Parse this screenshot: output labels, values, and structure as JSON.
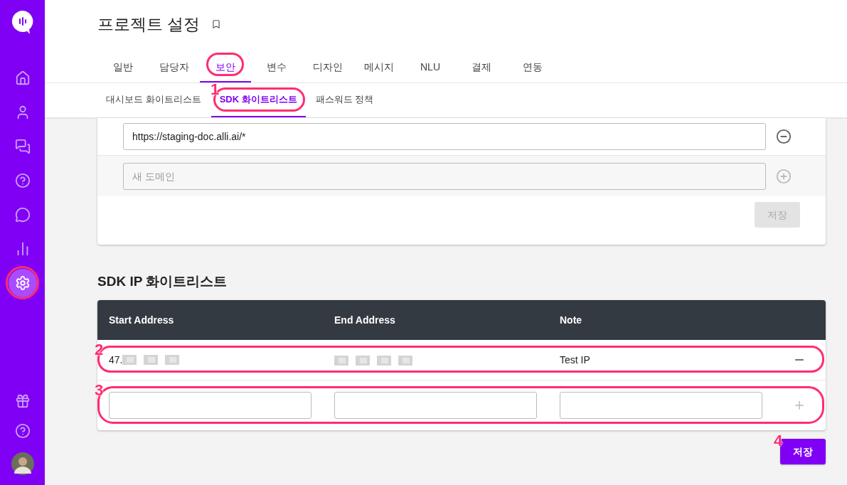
{
  "sidebar": {
    "nav": [
      {
        "kind": "home",
        "selected": false
      },
      {
        "kind": "user",
        "selected": false
      },
      {
        "kind": "chat",
        "selected": false
      },
      {
        "kind": "help",
        "selected": false
      },
      {
        "kind": "message",
        "selected": false
      },
      {
        "kind": "stats",
        "selected": false
      },
      {
        "kind": "settings",
        "selected": true
      }
    ],
    "bottom": [
      {
        "kind": "gift"
      },
      {
        "kind": "help"
      },
      {
        "kind": "avatar"
      }
    ]
  },
  "title": "프로젝트 설정",
  "tabs": [
    {
      "label": "일반",
      "selected": false
    },
    {
      "label": "담당자",
      "selected": false
    },
    {
      "label": "보안",
      "selected": true
    },
    {
      "label": "변수",
      "selected": false
    },
    {
      "label": "디자인",
      "selected": false
    },
    {
      "label": "메시지",
      "selected": false
    },
    {
      "label": "NLU",
      "selected": false
    },
    {
      "label": "결제",
      "selected": false
    },
    {
      "label": "연동",
      "selected": false
    }
  ],
  "subtabs": [
    {
      "label": "대시보드 화이트리스트",
      "selected": false
    },
    {
      "label": "SDK 화이트리스트",
      "selected": true
    },
    {
      "label": "패스워드 정책",
      "selected": false
    }
  ],
  "domains": {
    "rows": [
      {
        "value": "https://staging-doc.alli.ai/*"
      }
    ],
    "new_row": {
      "placeholder": "새 도메인"
    },
    "save": {
      "label": "저장",
      "disabled": true
    }
  },
  "ip_whitelist": {
    "title": "SDK IP 화이트리스트",
    "columns": [
      "Start Address",
      "End Address",
      "Note"
    ],
    "rows": [
      {
        "start": "47.",
        "note": "Test IP",
        "redacted": true
      }
    ],
    "save": {
      "label": "저장",
      "disabled": false
    }
  },
  "annotations": [
    {
      "label": "1"
    },
    {
      "label": "2"
    },
    {
      "label": "3"
    },
    {
      "label": "4"
    }
  ]
}
